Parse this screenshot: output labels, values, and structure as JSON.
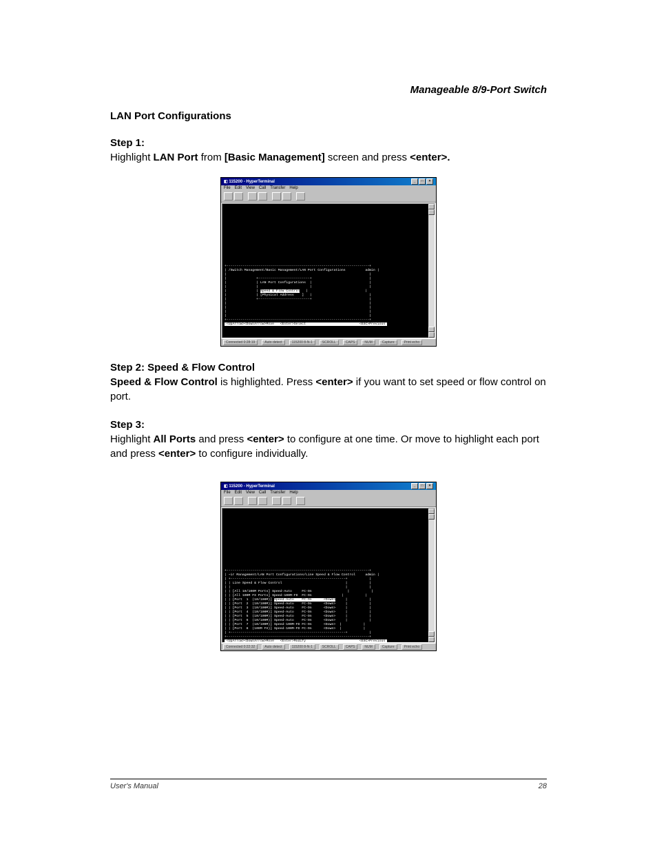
{
  "header": {
    "right": "Manageable 8/9-Port Switch"
  },
  "section_title": "LAN Port Configurations",
  "step1": {
    "label": "Step 1:",
    "pre": "Highlight ",
    "b1": "LAN Port",
    "mid1": " from ",
    "b2": "[Basic Management]",
    "mid2": " screen and press ",
    "b3": "<enter>.",
    "tail": ""
  },
  "step2": {
    "label": "Step 2: Speed & Flow Control",
    "b1": "Speed & Flow Control",
    "mid1": " is highlighted. Press ",
    "b2": "<enter>",
    "tail": " if you want to set speed or flow control on port."
  },
  "step3": {
    "label": "Step 3:",
    "pre": "Highlight ",
    "b1": "All Ports",
    "mid1": " and press ",
    "b2": "<enter>",
    "mid2": " to configure at one time. Or move to highlight each port and press ",
    "b3": "<enter>",
    "tail": " to configure individually."
  },
  "ht": {
    "title": "115200 - HyperTerminal",
    "menu": [
      "File",
      "Edit",
      "View",
      "Call",
      "Transfer",
      "Help"
    ],
    "status": {
      "a": [
        "Connected 0:28:19",
        "Auto detect",
        "115200 8-N-1",
        "SCROLL",
        "CAPS",
        "NUM",
        "Capture",
        "Print echo"
      ],
      "b": [
        "Connected 0:22:32",
        "Auto detect",
        "115200 8-N-1",
        "SCROLL",
        "CAPS",
        "NUM",
        "Capture",
        "Print echo"
      ]
    }
  },
  "term1": {
    "path": "/Switch Management/Basic Management/LAN Port Configurations",
    "user": "admin",
    "box_title": "LAN Port Configurations",
    "opt_sel": "Speed & Flow Control",
    "opt2": "[Physical Address    ]",
    "hint_left": "<UpArrow><DownArrow>Move   <Enter>Select",
    "hint_right": "<ESC>Previous"
  },
  "term2": {
    "path": "~ir Management/LAN Port Configurations/Line Speed & Flow Control",
    "user": "admin",
    "box_title": "Line Speed & Flow Control",
    "rows": [
      "[All 10/100M Ports] Speed-Auto     FC-On",
      "[All 100M FX Ports] Speed-100M-FD  FC-On",
      "[Port  1  (10/100M)] ",
      "[Port  2  (10/100M)] Speed-Auto    FC-On      <Down>",
      "[Port  3  (10/100M)] Speed-Auto    FC-On      <Down>",
      "[Port  4  (10/100M)] Speed-Auto    FC-On      <Down>",
      "[Port  5  (10/100M)] Speed-Auto    FC-On      <Down>",
      "[Port  6  (10/100M)] Speed-Auto    FC-On      <Down>",
      "[Port  7  (10/100M)] Speed-100M-FD FC-On      <Down>",
      "[Port  8  (100M FX)] Speed-100M-FD FC-On      <Down>"
    ],
    "sel_row": "Speed-Auto    FC-On      <Down>",
    "hint_left": "<UpArrow><DownArrow>Move   <Enter>Modify",
    "hint_right": "<ESC>Previous"
  },
  "footer": {
    "left": "User's Manual",
    "right": "28"
  }
}
